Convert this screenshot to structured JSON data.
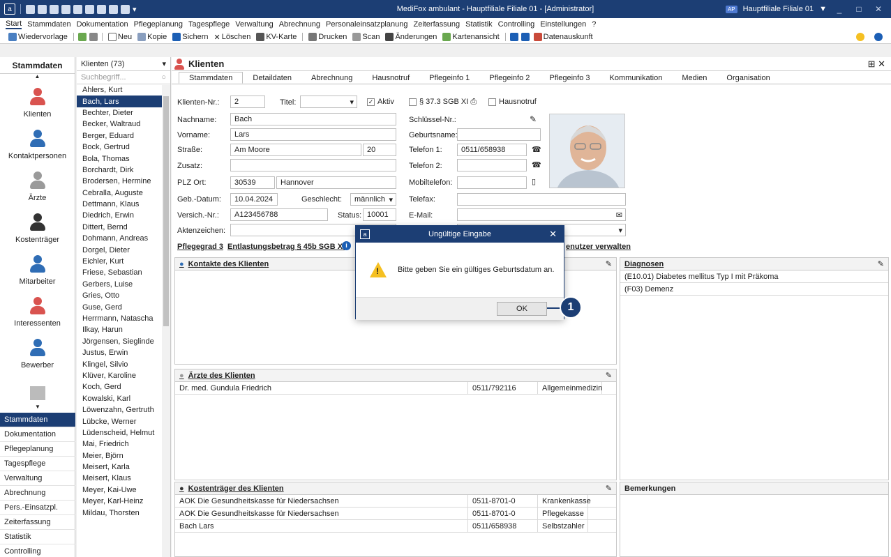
{
  "window": {
    "title": "MediFox ambulant  -  Hauptfiliale Filiale 01 - [Administrator]",
    "branch": "Hauptfiliale Filiale 01",
    "branch_badge": "AP"
  },
  "menu": [
    "Start",
    "Stammdaten",
    "Dokumentation",
    "Pflegeplanung",
    "Tagespflege",
    "Verwaltung",
    "Abrechnung",
    "Personaleinsatzplanung",
    "Zeiterfassung",
    "Statistik",
    "Controlling",
    "Einstellungen",
    "?"
  ],
  "toolbar": {
    "wiedervorlage": "Wiedervorlage",
    "neu": "Neu",
    "kopie": "Kopie",
    "sichern": "Sichern",
    "loeschen": "Löschen",
    "kvkarte": "KV-Karte",
    "drucken": "Drucken",
    "scan": "Scan",
    "aenderungen": "Änderungen",
    "kartenansicht": "Kartenansicht",
    "datenauskunft": "Datenauskunft"
  },
  "sidebar": {
    "title": "Stammdaten",
    "items": [
      "Klienten",
      "Kontaktpersonen",
      "Ärzte",
      "Kostenträger",
      "Mitarbeiter",
      "Interessenten",
      "Bewerber"
    ],
    "nav": [
      "Stammdaten",
      "Dokumentation",
      "Pflegeplanung",
      "Tagespflege",
      "Verwaltung",
      "Abrechnung",
      "Pers.-Einsatzpl.",
      "Zeiterfassung",
      "Statistik",
      "Controlling"
    ]
  },
  "clientlist": {
    "header": "Klienten (73)",
    "search_placeholder": "Suchbegriff...",
    "clients": [
      "Ahlers, Kurt",
      "Bach, Lars",
      "Bechter, Dieter",
      "Becker, Waltraud",
      "Berger, Eduard",
      "Bock, Gertrud",
      "Bola, Thomas",
      "Borchardt, Dirk",
      "Brodersen, Hermine",
      "Cebralla, Auguste",
      "Dettmann, Klaus",
      "Diedrich, Erwin",
      "Dittert, Bernd",
      "Dohmann, Andreas",
      "Dorgel, Dieter",
      "Eichler, Kurt",
      "Friese, Sebastian",
      "Gerbers, Luise",
      "Gries, Otto",
      "Guse, Gerd",
      "Herrmann, Natascha",
      "Ilkay, Harun",
      "Jörgensen, Sieglinde",
      "Justus, Erwin",
      "Klingel, Silvio",
      "Klüver, Karoline",
      "Koch, Gerd",
      "Kowalski, Karl",
      "Löwenzahn, Gertruth",
      "Lübcke, Werner",
      "Lüdenscheid, Helmut",
      "Mai, Friedrich",
      "Meier, Björn",
      "Meisert, Karla",
      "Meisert, Klaus",
      "Meyer, Kai-Uwe",
      "Meyer, Karl-Heinz",
      "Mildau, Thorsten"
    ],
    "selected": "Bach, Lars"
  },
  "main": {
    "title": "Klienten",
    "tabs": [
      "Stammdaten",
      "Detaildaten",
      "Abrechnung",
      "Hausnotruf",
      "Pflegeinfo 1",
      "Pflegeinfo 2",
      "Pflegeinfo 3",
      "Kommunikation",
      "Medien",
      "Organisation"
    ]
  },
  "form": {
    "klienten_nr_label": "Klienten-Nr.:",
    "klienten_nr": "2",
    "titel_label": "Titel:",
    "aktiv_label": "Aktiv",
    "sgb_label": "§ 37.3 SGB XI",
    "hausnotruf_label": "Hausnotruf",
    "nachname_label": "Nachname:",
    "nachname": "Bach",
    "vorname_label": "Vorname:",
    "vorname": "Lars",
    "strasse_label": "Straße:",
    "strasse": "Am Moore",
    "hausnr": "20",
    "zusatz_label": "Zusatz:",
    "plz_label": "PLZ Ort:",
    "plz": "30539",
    "ort": "Hannover",
    "geb_label": "Geb.-Datum:",
    "geb": "10.04.2024",
    "geschlecht_label": "Geschlecht:",
    "geschlecht": "männlich",
    "versich_label": "Versich.-Nr.:",
    "versich": "A123456788",
    "status_label": "Status:",
    "status": "10001",
    "aktenzeichen_label": "Aktenzeichen:",
    "schluessel_label": "Schlüssel-Nr.:",
    "geburtsname_label": "Geburtsname:",
    "tel1_label": "Telefon 1:",
    "tel1": "0511/658938",
    "tel2_label": "Telefon 2:",
    "mobil_label": "Mobiltelefon:",
    "telefax_label": "Telefax:",
    "email_label": "E-Mail:",
    "pflegegrad": "Pflegegrad 3",
    "entlastung": "Entlastungsbetrag § 45b SGB XI",
    "benutzer": "Benutzer verwalten",
    "benutzer_visible": "enutzer verwalten"
  },
  "panels": {
    "kontakte_title": "Kontakte des Klienten",
    "aerzte_title": "Ärzte des Klienten",
    "aerzte": [
      {
        "name": "Dr. med. Gundula Friedrich",
        "tel": "0511/792116",
        "fach": "Allgemeinmedizin"
      }
    ],
    "kosten_title": "Kostenträger des Klienten",
    "kosten": [
      {
        "name": "AOK Die Gesundheitskasse für Niedersachsen",
        "tel": "0511-8701-0",
        "art": "Krankenkasse"
      },
      {
        "name": "AOK Die Gesundheitskasse für Niedersachsen",
        "tel": "0511-8701-0",
        "art": "Pflegekasse"
      },
      {
        "name": "Bach Lars",
        "tel": "0511/658938",
        "art": "Selbstzahler"
      }
    ],
    "diagnosen_title": "Diagnosen",
    "diagnosen": [
      "(E10.01) Diabetes mellitus Typ I mit Präkoma",
      "(F03) Demenz"
    ],
    "bemerkungen_title": "Bemerkungen"
  },
  "dialog": {
    "title": "Ungültige Eingabe",
    "message": "Bitte geben Sie ein gültiges Geburtsdatum an.",
    "ok": "OK",
    "callout": "1"
  },
  "colors": {
    "accent": "#1c3e74",
    "person_red": "#d9534f",
    "person_blue": "#2f6db5",
    "person_gray": "#9a9a9a"
  }
}
